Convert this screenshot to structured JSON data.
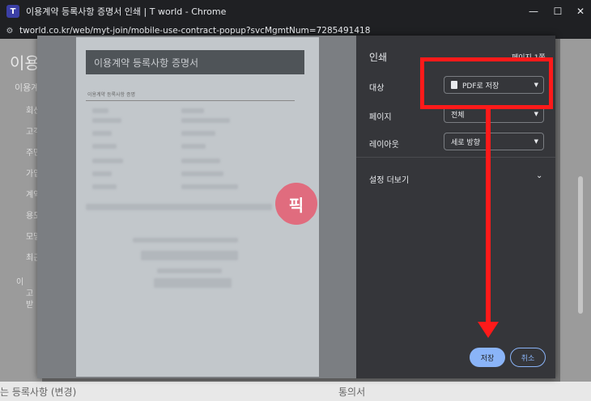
{
  "window": {
    "title": "이용계약 등록사항 증명서 인쇄 | T world - Chrome",
    "favicon": "T"
  },
  "controls": {
    "minimize": "—",
    "maximize": "☐",
    "close": "✕"
  },
  "address": {
    "url": "tworld.co.kr/web/myt-join/mobile-use-contract-popup?svcMgmtNum=7285491418"
  },
  "background": {
    "title": "이용",
    "subtitle": "이용계",
    "items": [
      "회선",
      "고객",
      "주민",
      "가입",
      "계약",
      "용도",
      "모델",
      "최근"
    ],
    "notice": "이",
    "notice2": "고",
    "notice3": "받",
    "bottom_left": "는 등록사항 (변경)",
    "bottom_right": "통의서"
  },
  "preview": {
    "doc_title": "이용계약 등록사항 증명서",
    "doc_subtitle": "이용계약 등록사항 증명",
    "badge": "픽"
  },
  "print": {
    "heading": "인쇄",
    "pages": "페이지 1쪽",
    "destination_label": "대상",
    "destination_value": "PDF로 저장",
    "pages_label": "페이지",
    "pages_value": "전체",
    "layout_label": "레이아웃",
    "layout_value": "세로 방향",
    "more_settings": "설정 더보기",
    "save": "저장",
    "cancel": "취소"
  },
  "colors": {
    "accent": "#8ab4f8",
    "annotation": "#ff1a1a"
  }
}
